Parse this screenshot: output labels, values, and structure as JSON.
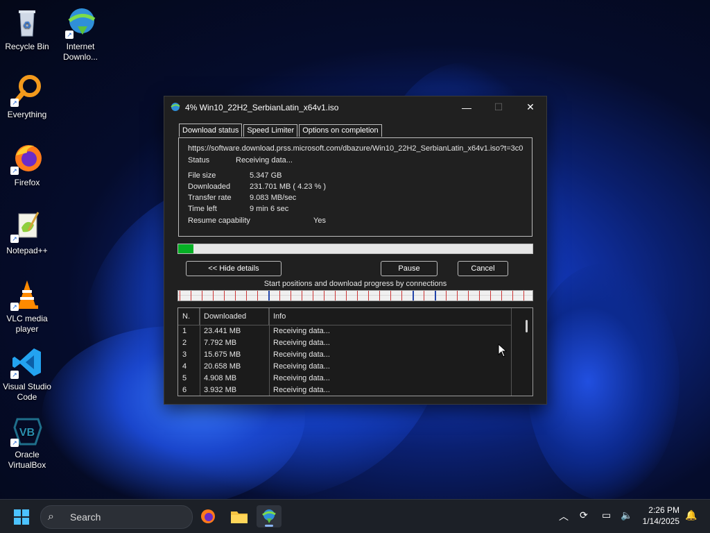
{
  "desktop": {
    "icons": [
      {
        "label": "Recycle Bin"
      },
      {
        "label": "Internet Downlo..."
      },
      {
        "label": "Everything"
      },
      {
        "label": "Firefox"
      },
      {
        "label": "Notepad++"
      },
      {
        "label": "VLC media player"
      },
      {
        "label": "Visual Studio Code"
      },
      {
        "label": "Oracle VirtualBox"
      }
    ]
  },
  "window": {
    "title": "4% Win10_22H2_SerbianLatin_x64v1.iso",
    "tabs": [
      "Download status",
      "Speed Limiter",
      "Options on completion"
    ],
    "url": "https://software.download.prss.microsoft.com/dbazure/Win10_22H2_SerbianLatin_x64v1.iso?t=3c0",
    "status_label": "Status",
    "status_value": "Receiving data...",
    "file_size_label": "File size",
    "file_size_value": "5.347  GB",
    "downloaded_label": "Downloaded",
    "downloaded_value": "231.701  MB  ( 4.23 % )",
    "transfer_rate_label": "Transfer rate",
    "transfer_rate_value": "9.083  MB/sec",
    "time_left_label": "Time left",
    "time_left_value": "9 min 6 sec",
    "resume_label": "Resume capability",
    "resume_value": "Yes",
    "progress_fraction": 0.0423,
    "buttons": {
      "hide_details": "<< Hide details",
      "pause": "Pause",
      "cancel": "Cancel"
    },
    "connections_label": "Start positions and download progress by connections",
    "table": {
      "headers": [
        "N.",
        "Downloaded",
        "Info"
      ],
      "rows": [
        {
          "n": "1",
          "downloaded": "23.441  MB",
          "info": "Receiving data..."
        },
        {
          "n": "2",
          "downloaded": "7.792  MB",
          "info": "Receiving data..."
        },
        {
          "n": "3",
          "downloaded": "15.675  MB",
          "info": "Receiving data..."
        },
        {
          "n": "4",
          "downloaded": "20.658  MB",
          "info": "Receiving data..."
        },
        {
          "n": "5",
          "downloaded": "4.908  MB",
          "info": "Receiving data..."
        },
        {
          "n": "6",
          "downloaded": "3.932  MB",
          "info": "Receiving data..."
        }
      ]
    }
  },
  "taskbar": {
    "search_placeholder": "Search",
    "time": "2:26 PM",
    "date": "1/14/2025"
  }
}
